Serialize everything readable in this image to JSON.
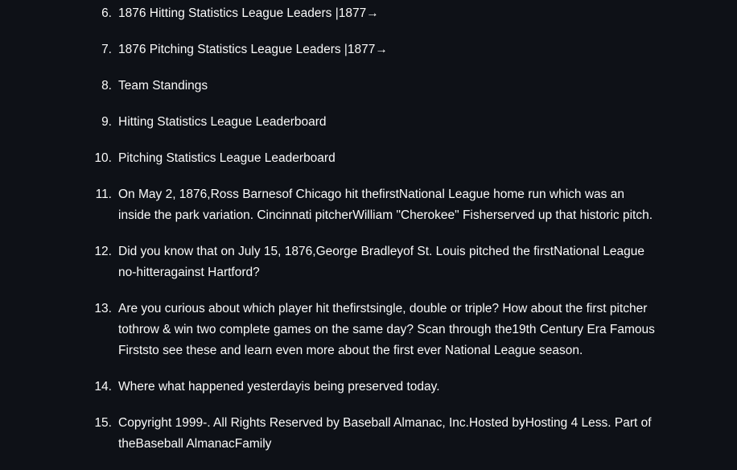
{
  "list": {
    "items": [
      {
        "num": "6.",
        "text": "1876 Hitting Statistics League Leaders |1877→"
      },
      {
        "num": "7.",
        "text": "1876 Pitching Statistics League Leaders |1877→"
      },
      {
        "num": "8.",
        "text": "Team Standings"
      },
      {
        "num": "9.",
        "text": "Hitting Statistics League Leaderboard"
      },
      {
        "num": "10.",
        "text": "Pitching Statistics League Leaderboard"
      },
      {
        "num": "11.",
        "text": "On May 2, 1876,Ross Barnesof Chicago hit thefirstNational League home run which was an inside the park variation. Cincinnati pitcherWilliam \"Cherokee\" Fisherserved up that historic pitch."
      },
      {
        "num": "12.",
        "text": "Did you know that on July 15, 1876,George Bradleyof St. Louis pitched the firstNational League no-hitteragainst Hartford?"
      },
      {
        "num": "13.",
        "text": "Are you curious about which player hit thefirstsingle, double or triple? How about the first pitcher tothrow & win two complete games on the same day? Scan through the19th Century Era Famous Firststo see these and learn even more about the first ever National League season."
      },
      {
        "num": "14.",
        "text": "Where what happened yesterdayis being preserved today."
      },
      {
        "num": "15.",
        "text": "Copyright 1999-. All Rights Reserved by Baseball Almanac, Inc.Hosted byHosting 4 Less. Part of theBaseball AlmanacFamily"
      }
    ]
  }
}
